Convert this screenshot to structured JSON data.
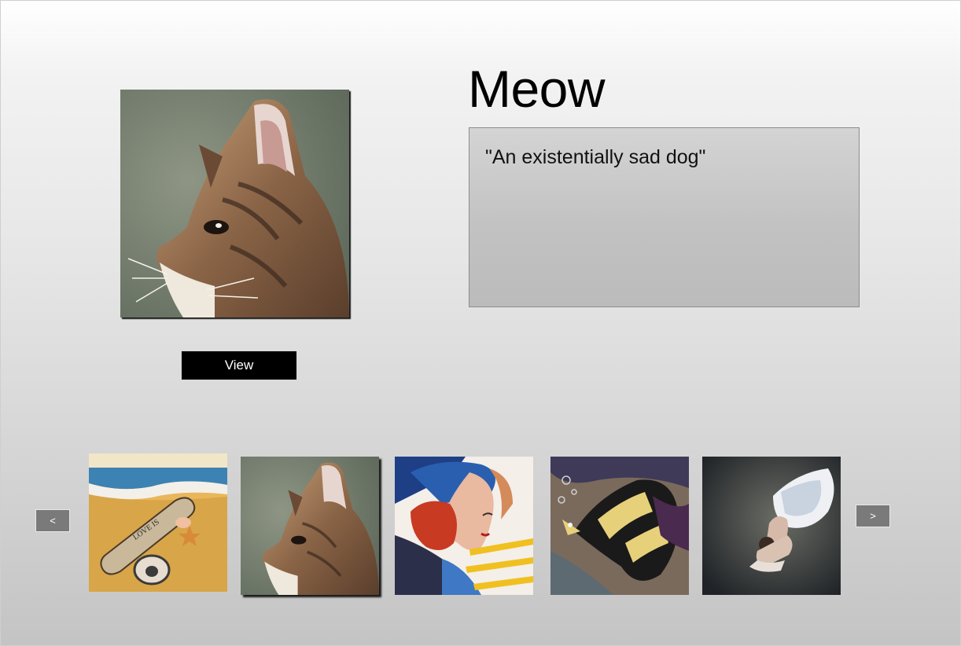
{
  "featured": {
    "title": "Meow",
    "description": "\"An existentially sad dog\"",
    "view_label": "View",
    "image_icon": "cat-painting"
  },
  "carousel": {
    "prev_label": "<",
    "next_label": ">",
    "active_index": 1,
    "thumbnails": [
      {
        "icon": "message-in-bottle-painting",
        "caption_on_image": "LOVE IS"
      },
      {
        "icon": "cat-painting"
      },
      {
        "icon": "woman-portrait-painting"
      },
      {
        "icon": "angelfish-painting"
      },
      {
        "icon": "ballerina-painting"
      }
    ]
  },
  "colors": {
    "button_bg": "#000000",
    "nav_bg": "#7a7a7a",
    "description_bg": "#c4c4c4",
    "description_border": "#8c8c8c"
  }
}
